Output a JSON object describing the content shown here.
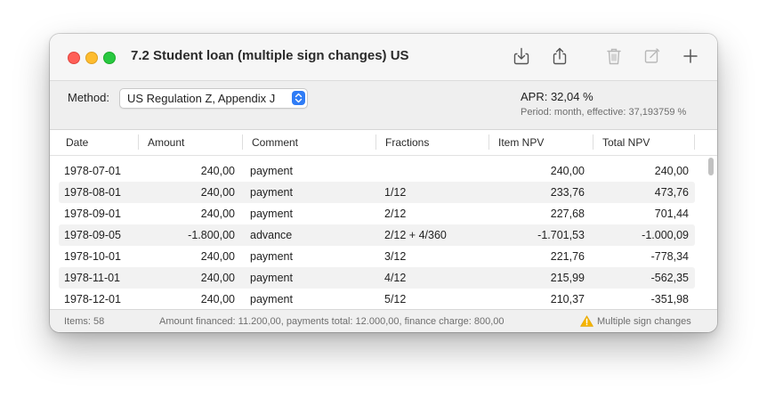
{
  "window": {
    "title": "7.2 Student loan (multiple sign changes) US"
  },
  "toolbar": {
    "icons": [
      "download-icon",
      "share-icon",
      "trash-icon",
      "compose-icon",
      "plus-icon"
    ]
  },
  "method": {
    "label": "Method:",
    "selected": "US Regulation Z, Appendix J"
  },
  "summary": {
    "apr": "APR: 32,04 %",
    "period": "Period: month, effective: 37,193759 %"
  },
  "table": {
    "headers": [
      "Date",
      "Amount",
      "Comment",
      "Fractions",
      "Item NPV",
      "Total NPV"
    ],
    "rows": [
      {
        "date": "1978-07-01",
        "amount": "240,00",
        "comment": "payment",
        "fractions": "",
        "item_npv": "240,00",
        "total_npv": "240,00"
      },
      {
        "date": "1978-08-01",
        "amount": "240,00",
        "comment": "payment",
        "fractions": "1/12",
        "item_npv": "233,76",
        "total_npv": "473,76"
      },
      {
        "date": "1978-09-01",
        "amount": "240,00",
        "comment": "payment",
        "fractions": "2/12",
        "item_npv": "227,68",
        "total_npv": "701,44"
      },
      {
        "date": "1978-09-05",
        "amount": "-1.800,00",
        "comment": "advance",
        "fractions": "2/12 + 4/360",
        "item_npv": "-1.701,53",
        "total_npv": "-1.000,09"
      },
      {
        "date": "1978-10-01",
        "amount": "240,00",
        "comment": "payment",
        "fractions": "3/12",
        "item_npv": "221,76",
        "total_npv": "-778,34"
      },
      {
        "date": "1978-11-01",
        "amount": "240,00",
        "comment": "payment",
        "fractions": "4/12",
        "item_npv": "215,99",
        "total_npv": "-562,35"
      },
      {
        "date": "1978-12-01",
        "amount": "240,00",
        "comment": "payment",
        "fractions": "5/12",
        "item_npv": "210,37",
        "total_npv": "-351,98"
      }
    ]
  },
  "status": {
    "items": "Items: 58",
    "summary": "Amount financed: 11.200,00, payments total: 12.000,00, finance charge: 800,00",
    "warning": "Multiple sign changes",
    "warning_icon": "warning-triangle-icon",
    "warning_color": "#f5b400"
  },
  "colors": {
    "close": "#ff5f57",
    "minimize": "#febc2e",
    "maximize": "#28c840",
    "accent": "#2f7cf6"
  }
}
